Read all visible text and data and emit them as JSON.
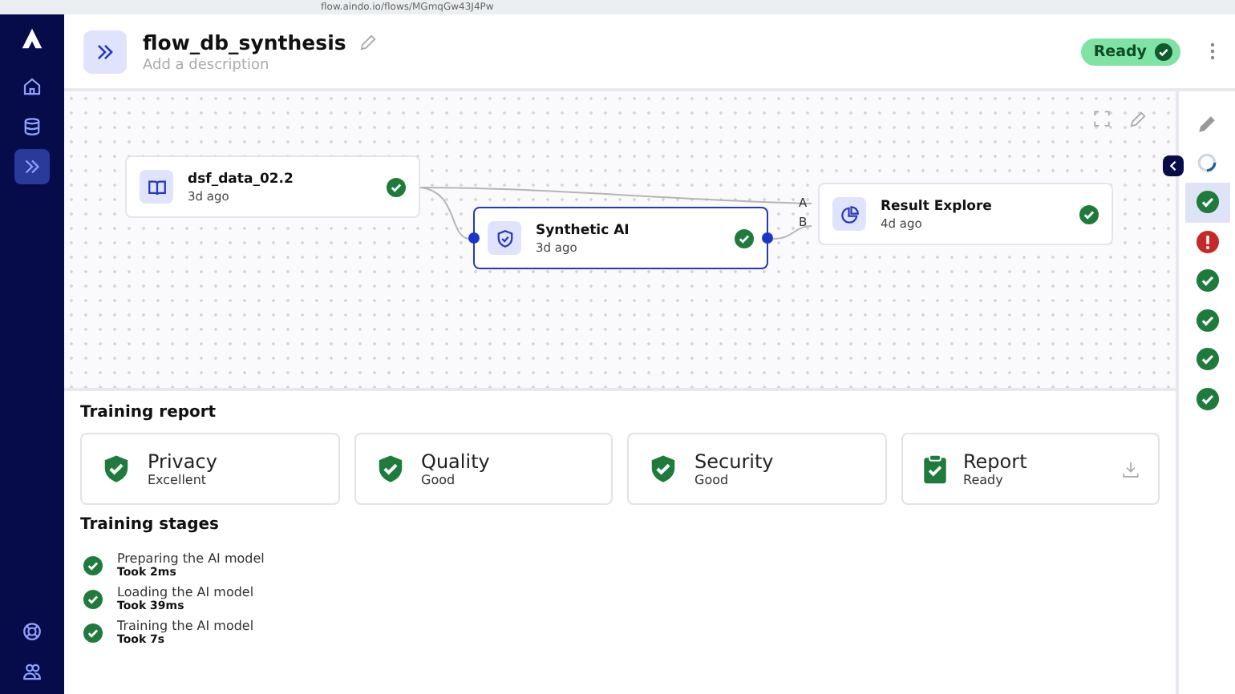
{
  "browser": {
    "url": "flow.aindo.io/flows/MGmqGw43J4Pw"
  },
  "sidebar": {
    "top_items": [
      {
        "kind": "home",
        "selected": false
      },
      {
        "kind": "database",
        "selected": false
      },
      {
        "kind": "flows",
        "selected": true
      }
    ],
    "bottom_items": [
      {
        "kind": "help",
        "selected": false
      },
      {
        "kind": "users",
        "selected": false
      }
    ]
  },
  "header": {
    "title": "flow_db_synthesis",
    "description_placeholder": "Add a description",
    "status": "Ready"
  },
  "canvas": {
    "nodes": [
      {
        "kind": "dataset",
        "name": "dsf_data_02.2",
        "time": "3d ago",
        "selected": false,
        "done": true
      },
      {
        "kind": "model",
        "name": "Synthetic AI",
        "time": "3d ago",
        "selected": true,
        "done": true
      },
      {
        "kind": "report",
        "name": "Result Explore",
        "time": "4d ago",
        "selected": false,
        "done": true,
        "ports": [
          "A",
          "B"
        ]
      }
    ]
  },
  "right_rail": [
    {
      "kind": "edit",
      "selected": false
    },
    {
      "kind": "progress",
      "selected": false
    },
    {
      "kind": "success",
      "selected": true
    },
    {
      "kind": "error",
      "selected": false
    },
    {
      "kind": "success",
      "selected": false
    },
    {
      "kind": "success",
      "selected": false
    },
    {
      "kind": "success",
      "selected": false
    },
    {
      "kind": "success",
      "selected": false
    }
  ],
  "training_report": {
    "title": "Training report",
    "cards": [
      {
        "kind": "check",
        "title": "Privacy",
        "value": "Excellent"
      },
      {
        "kind": "check",
        "title": "Quality",
        "value": "Good"
      },
      {
        "kind": "check",
        "title": "Security",
        "value": "Good"
      },
      {
        "kind": "report",
        "title": "Report",
        "value": "Ready"
      }
    ]
  },
  "training_stages": {
    "title": "Training stages",
    "stages": [
      {
        "name": "Preparing the AI model",
        "duration": "Took 2ms",
        "done": true
      },
      {
        "name": "Loading the AI model",
        "duration": "Took 39ms",
        "done": true
      },
      {
        "name": "Training the AI model",
        "duration": "Took 7s",
        "done": true
      }
    ]
  }
}
